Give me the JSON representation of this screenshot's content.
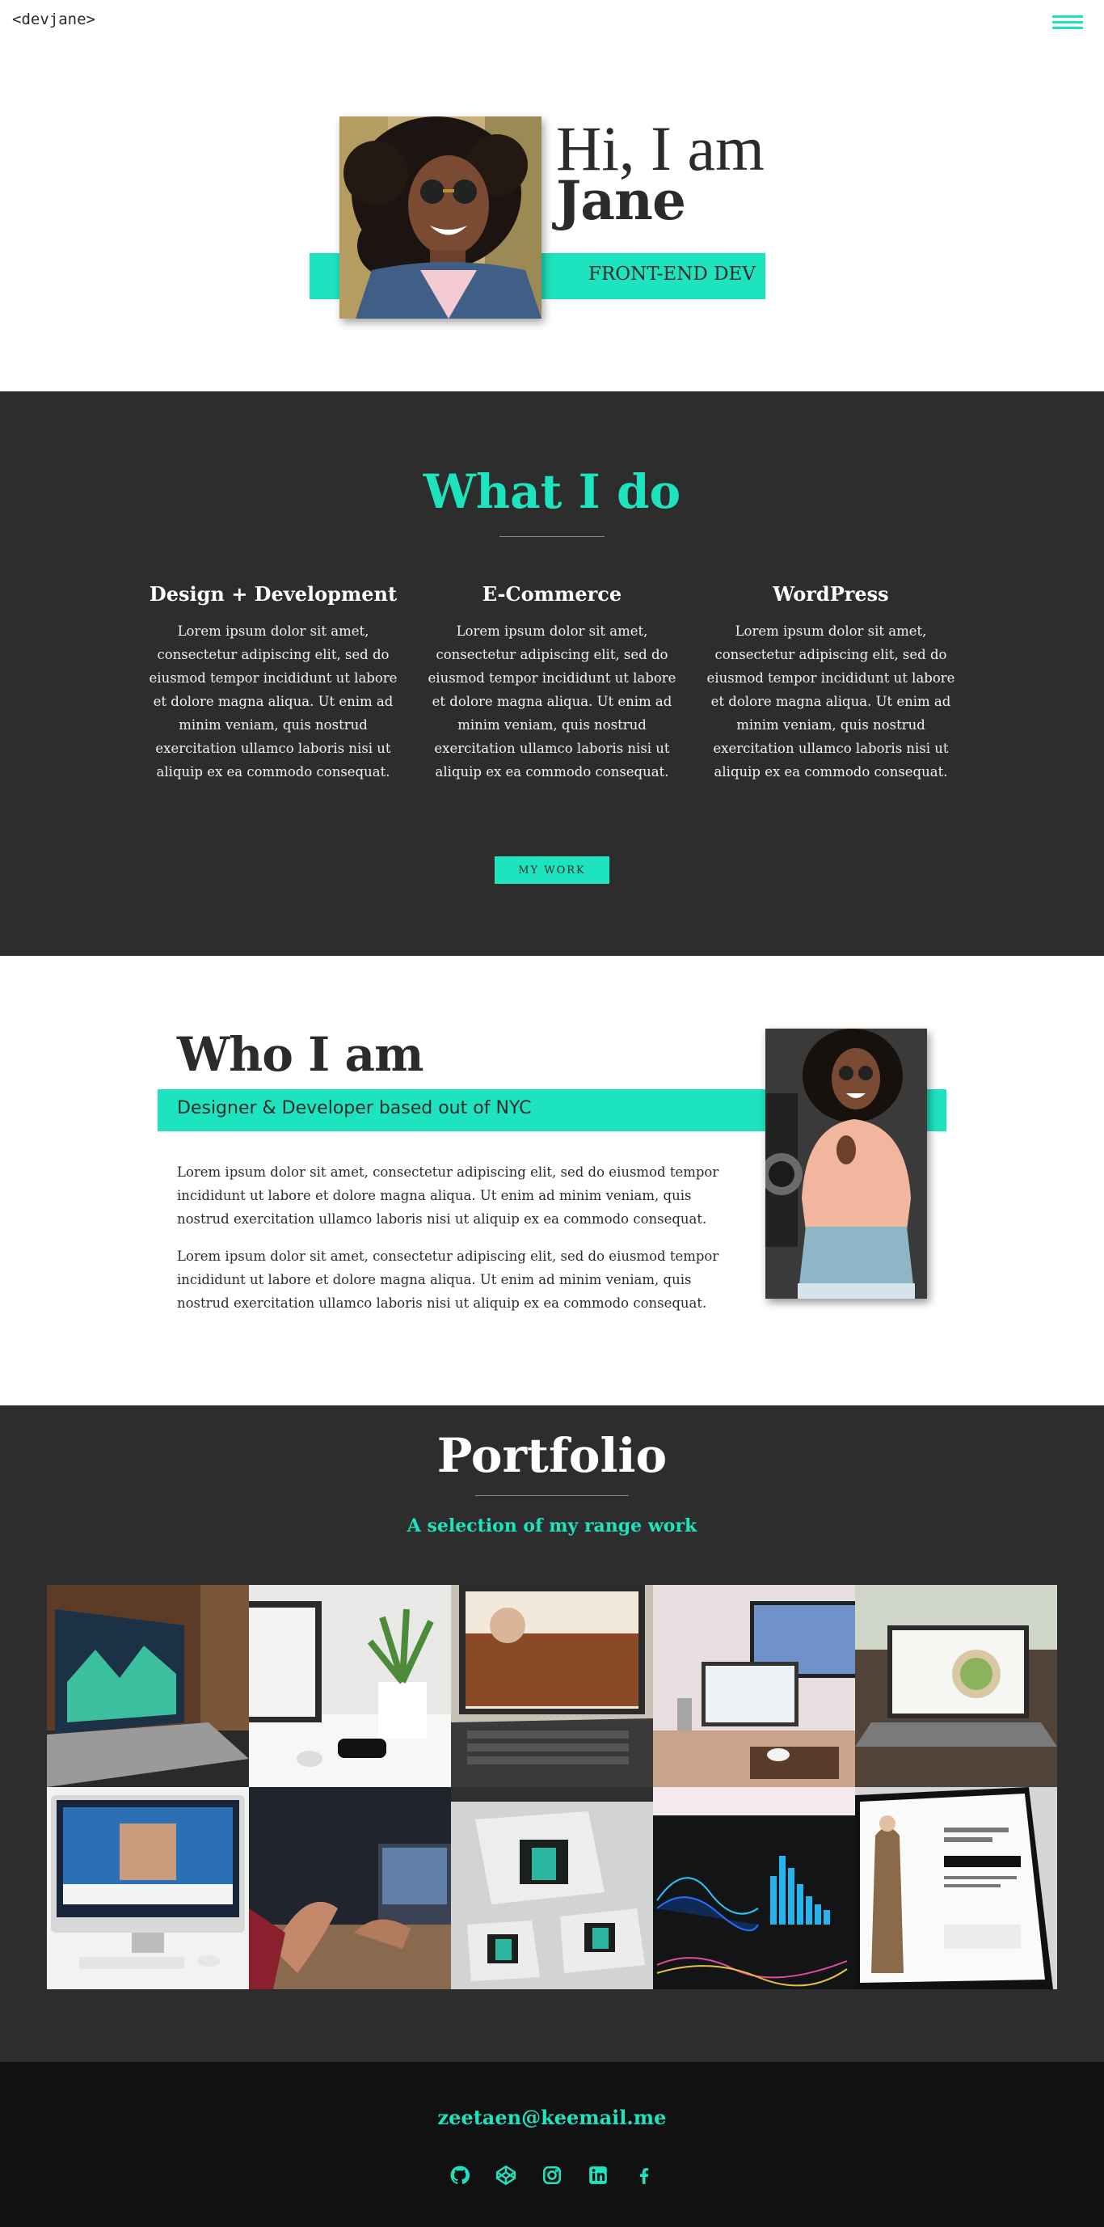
{
  "brand": {
    "logo_text": "<devjane>",
    "accent": "#1ee3bf",
    "dark_bg": "#2d2d2d",
    "footer_bg": "#111111"
  },
  "nav": {
    "menu_icon": "hamburger-menu-icon"
  },
  "hero": {
    "greeting": "Hi, I am",
    "name": "Jane",
    "role": "FRONT-END DEV",
    "photo": "portrait-woman-curly-hair-sunglasses-denim-jacket"
  },
  "services": {
    "title": "What I do",
    "items": [
      {
        "title": "Design + Development",
        "text": "Lorem ipsum dolor sit amet, consectetur adipiscing elit, sed do eiusmod tempor incididunt ut labore et dolore magna aliqua. Ut enim ad minim veniam, quis nostrud exercitation ullamco laboris nisi ut aliquip ex ea commodo consequat."
      },
      {
        "title": "E-Commerce",
        "text": "Lorem ipsum dolor sit amet, consectetur adipiscing elit, sed do eiusmod tempor incididunt ut labore et dolore magna aliqua. Ut enim ad minim veniam, quis nostrud exercitation ullamco laboris nisi ut aliquip ex ea commodo consequat."
      },
      {
        "title": "WordPress",
        "text": "Lorem ipsum dolor sit amet, consectetur adipiscing elit, sed do eiusmod tempor incididunt ut labore et dolore magna aliqua. Ut enim ad minim veniam, quis nostrud exercitation ullamco laboris nisi ut aliquip ex ea commodo consequat."
      }
    ],
    "button_label": "MY WORK"
  },
  "about": {
    "title": "Who I am",
    "subtitle": "Designer & Developer based out of NYC",
    "paragraphs": [
      "Lorem ipsum dolor sit amet, consectetur adipiscing elit, sed do eiusmod tempor incididunt ut labore et dolore magna aliqua. Ut enim ad minim veniam, quis nostrud exercitation ullamco laboris nisi ut aliquip ex ea commodo consequat.",
      "Lorem ipsum dolor sit amet, consectetur adipiscing elit, sed do eiusmod tempor incididunt ut labore et dolore magna aliqua. Ut enim ad minim veniam, quis nostrud exercitation ullamco laboris nisi ut aliquip ex ea commodo consequat."
    ],
    "photo": "portrait-woman-pink-sweater-sunglasses"
  },
  "portfolio": {
    "title": "Portfolio",
    "subtitle": "A selection of my range work",
    "items": [
      {
        "name": "laptop-analytics-dashboard"
      },
      {
        "name": "laptop-plant-desk"
      },
      {
        "name": "laptop-website-keyboard"
      },
      {
        "name": "laptop-monitor-desk"
      },
      {
        "name": "laptop-food-website"
      },
      {
        "name": "imac-website"
      },
      {
        "name": "people-meeting-laptops"
      },
      {
        "name": "logo-brand-cards"
      },
      {
        "name": "dark-data-dashboard"
      },
      {
        "name": "fashion-ecommerce-tablet"
      }
    ]
  },
  "footer": {
    "email": "zeetaen@keemail.me",
    "socials": [
      "github-icon",
      "codepen-icon",
      "instagram-icon",
      "linkedin-icon",
      "facebook-icon"
    ]
  }
}
